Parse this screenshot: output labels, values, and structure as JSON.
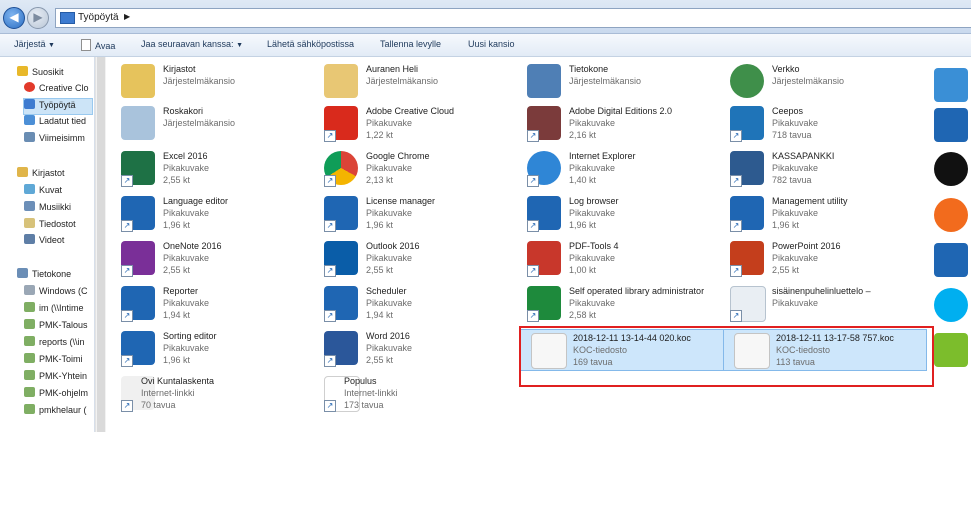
{
  "address": {
    "location": "Työpöytä"
  },
  "toolbar": {
    "organize": "Järjestä",
    "open": "Avaa",
    "share": "Jaa seuraavan kanssa:",
    "email": "Lähetä sähköpostissa",
    "burn": "Tallenna levylle",
    "new_folder": "Uusi kansio"
  },
  "nav": {
    "favorites_label": "Suosikit",
    "favorites": [
      "Creative Clo",
      "Työpöytä",
      "Ladatut tied",
      "Viimeisimm"
    ],
    "libraries_label": "Kirjastot",
    "libraries": [
      "Kuvat",
      "Musiikki",
      "Tiedostot",
      "Videot"
    ],
    "computer_label": "Tietokone",
    "computer": [
      "Windows (C",
      "im (\\\\Intime",
      "PMK-Talous",
      "reports (\\\\in",
      "PMK-Toimi",
      "PMK-Yhtein",
      "PMK-ohjelm",
      "pmkhelaur ("
    ]
  },
  "items": [
    {
      "name": "Kirjastot",
      "type": "Järjestelmäkansio",
      "size": ""
    },
    {
      "name": "Auranen Heli",
      "type": "Järjestelmäkansio",
      "size": ""
    },
    {
      "name": "Tietokone",
      "type": "Järjestelmäkansio",
      "size": ""
    },
    {
      "name": "Verkko",
      "type": "Järjestelmäkansio",
      "size": ""
    },
    {
      "name": "Roskakori",
      "type": "Järjestelmäkansio",
      "size": ""
    },
    {
      "name": "Adobe Creative Cloud",
      "type": "Pikakuvake",
      "size": "1,22 kt"
    },
    {
      "name": "Adobe Digital Editions 2.0",
      "type": "Pikakuvake",
      "size": "2,16 kt"
    },
    {
      "name": "Ceepos",
      "type": "Pikakuvake",
      "size": "718 tavua"
    },
    {
      "name": "Excel 2016",
      "type": "Pikakuvake",
      "size": "2,55 kt"
    },
    {
      "name": "Google Chrome",
      "type": "Pikakuvake",
      "size": "2,13 kt"
    },
    {
      "name": "Internet Explorer",
      "type": "Pikakuvake",
      "size": "1,40 kt"
    },
    {
      "name": "KASSAPANKKI",
      "type": "Pikakuvake",
      "size": "782 tavua"
    },
    {
      "name": "Language editor",
      "type": "Pikakuvake",
      "size": "1,96 kt"
    },
    {
      "name": "License manager",
      "type": "Pikakuvake",
      "size": "1,96 kt"
    },
    {
      "name": "Log browser",
      "type": "Pikakuvake",
      "size": "1,96 kt"
    },
    {
      "name": "Management utility",
      "type": "Pikakuvake",
      "size": "1,96 kt"
    },
    {
      "name": "OneNote 2016",
      "type": "Pikakuvake",
      "size": "2,55 kt"
    },
    {
      "name": "Outlook 2016",
      "type": "Pikakuvake",
      "size": "2,55 kt"
    },
    {
      "name": "PDF-Tools 4",
      "type": "Pikakuvake",
      "size": "1,00 kt"
    },
    {
      "name": "PowerPoint 2016",
      "type": "Pikakuvake",
      "size": "2,55 kt"
    },
    {
      "name": "Reporter",
      "type": "Pikakuvake",
      "size": "1,94 kt"
    },
    {
      "name": "Scheduler",
      "type": "Pikakuvake",
      "size": "1,94 kt"
    },
    {
      "name": "Self operated library administrator",
      "type": "Pikakuvake",
      "size": "2,58 kt"
    },
    {
      "name": "sisäinenpuhelinluettelo –",
      "type": "Pikakuvake",
      "size": ""
    },
    {
      "name": "Sorting editor",
      "type": "Pikakuvake",
      "size": "1,96 kt"
    },
    {
      "name": "Word 2016",
      "type": "Pikakuvake",
      "size": "2,55 kt"
    },
    {
      "name": "2018-12-11 13-14-44 020.koc",
      "type": "KOC-tiedosto",
      "size": "169 tavua"
    },
    {
      "name": "2018-12-11 13-17-58 757.koc",
      "type": "KOC-tiedosto",
      "size": "113 tavua"
    },
    {
      "name": "Ovi Kuntalaskenta",
      "type": "Internet-linkki",
      "size": "70 tavua"
    },
    {
      "name": "Populus",
      "type": "Internet-linkki",
      "size": "173 tavua"
    }
  ],
  "colors": {
    "selection_bg": "#cde6fb",
    "selection_border": "#84b9ea",
    "highlight": "#e02020"
  }
}
